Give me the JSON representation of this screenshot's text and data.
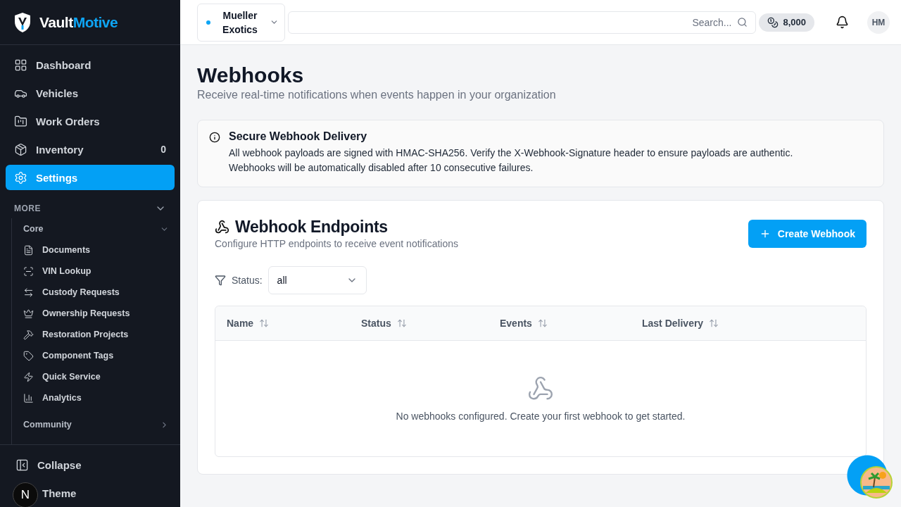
{
  "brand": {
    "first": "Vault",
    "second": "Motive"
  },
  "nav": [
    {
      "label": "Dashboard",
      "selected": false
    },
    {
      "label": "Vehicles",
      "selected": false
    },
    {
      "label": "Work Orders",
      "selected": false
    },
    {
      "label": "Inventory",
      "selected": false,
      "count": "0"
    },
    {
      "label": "Settings",
      "selected": true
    }
  ],
  "more": {
    "title": "MORE",
    "expanded": true,
    "groups": [
      {
        "title": "Core",
        "expanded": true,
        "items": [
          {
            "label": "Documents"
          },
          {
            "label": "VIN Lookup"
          },
          {
            "label": "Custody Requests"
          },
          {
            "label": "Ownership Requests"
          },
          {
            "label": "Restoration Projects"
          },
          {
            "label": "Component Tags"
          },
          {
            "label": "Quick Service"
          },
          {
            "label": "Analytics"
          }
        ]
      },
      {
        "title": "Community",
        "expanded": false
      }
    ]
  },
  "footer": [
    {
      "label": "Collapse"
    },
    {
      "label": "Theme"
    }
  ],
  "badge": "N",
  "topbar": {
    "org": "Mueller Exotics",
    "search": {
      "placeholder": "Search..."
    },
    "credits": "8,000",
    "avatar": "HM"
  },
  "page": {
    "title": "Webhooks",
    "subtitle": "Receive real-time notifications when events happen in your organization"
  },
  "notice": {
    "title": "Secure Webhook Delivery",
    "lines": [
      "All webhook payloads are signed with HMAC-SHA256. Verify the X-Webhook-Signature header to ensure payloads are authentic.",
      "Webhooks will be automatically disabled after 10 consecutive failures."
    ]
  },
  "endpoints": {
    "title": "Webhook Endpoints",
    "subtitle": "Configure HTTP endpoints to receive event notifications",
    "create": "Create Webhook",
    "filter": {
      "label": "Status:",
      "value": "all"
    },
    "columns": [
      "Name",
      "Status",
      "Events",
      "Last Delivery"
    ],
    "empty": "No webhooks configured. Create your first webhook to get started."
  }
}
